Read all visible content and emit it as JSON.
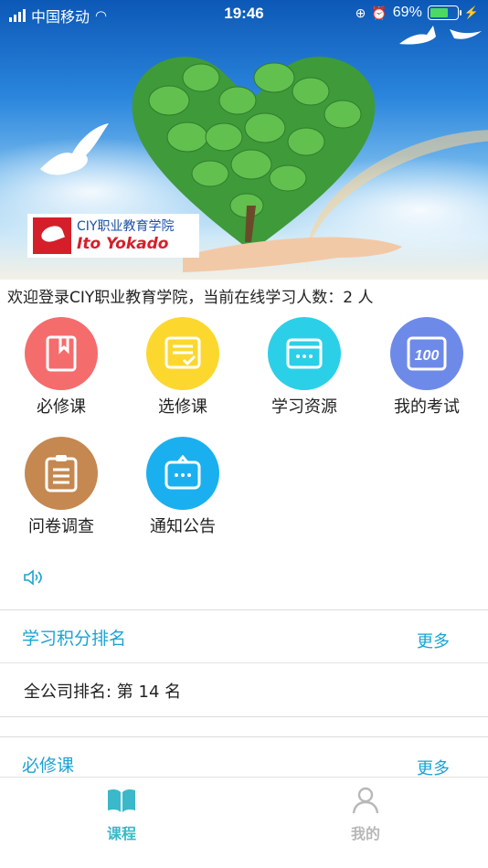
{
  "status_bar": {
    "carrier": "中国移动",
    "time": "19:46",
    "battery": "69%"
  },
  "banner": {
    "logo_line1": "CIY职业教育学院",
    "logo_line2": "Ito Yokado"
  },
  "welcome_text": "欢迎登录CIY职业教育学院，当前在线学习人数：2 人",
  "menu": [
    {
      "label": "必修课",
      "icon": "book-icon",
      "color": "#f56c6c"
    },
    {
      "label": "选修课",
      "icon": "checklist-icon",
      "color": "#fcd82f"
    },
    {
      "label": "学习资源",
      "icon": "window-icon",
      "color": "#2ccfe8"
    },
    {
      "label": "我的考试",
      "icon": "score-100-icon",
      "color": "#6e8ae8"
    },
    {
      "label": "问卷调查",
      "icon": "clipboard-icon",
      "color": "#c48850"
    },
    {
      "label": "通知公告",
      "icon": "message-icon",
      "color": "#1ab0ef"
    }
  ],
  "ranking": {
    "title": "学习积分排名",
    "more": "更多",
    "company_rank": "全公司排名: 第 14 名"
  },
  "required_course": {
    "title": "必修课",
    "more": "更多"
  },
  "tabs": [
    {
      "label": "课程",
      "icon": "book-open-icon",
      "active": true,
      "color": "#3bb8c9"
    },
    {
      "label": "我的",
      "icon": "user-icon",
      "active": false,
      "color": "#b8b8b8"
    }
  ],
  "colors": {
    "accent": "#1aa3d4",
    "tab_active": "#3bb8c9"
  }
}
